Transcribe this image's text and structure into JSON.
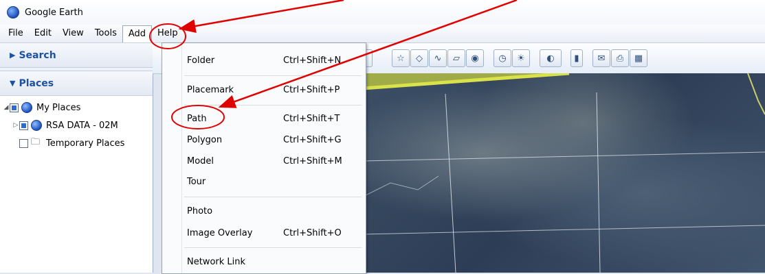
{
  "window": {
    "title": "Google Earth"
  },
  "menubar": {
    "items": [
      {
        "label": "File"
      },
      {
        "label": "Edit"
      },
      {
        "label": "View"
      },
      {
        "label": "Tools"
      },
      {
        "label": "Add",
        "active": true
      },
      {
        "label": "Help"
      }
    ]
  },
  "left_panel": {
    "search_label": "Search",
    "places_label": "Places",
    "tree": [
      {
        "label": "My Places",
        "checked": true,
        "icon": "globe-icon"
      },
      {
        "label": "RSA DATA - 02M",
        "checked": true,
        "icon": "globe-icon"
      },
      {
        "label": "Temporary Places",
        "checked": false,
        "icon": "folder-icon"
      }
    ]
  },
  "add_menu": {
    "items": [
      {
        "label": "Folder",
        "shortcut": "Ctrl+Shift+N"
      },
      {
        "label": "Placemark",
        "shortcut": "Ctrl+Shift+P"
      },
      {
        "label": "Path",
        "shortcut": "Ctrl+Shift+T"
      },
      {
        "label": "Polygon",
        "shortcut": "Ctrl+Shift+G"
      },
      {
        "label": "Model",
        "shortcut": "Ctrl+Shift+M"
      },
      {
        "label": "Tour",
        "shortcut": ""
      },
      {
        "label": "Photo",
        "shortcut": ""
      },
      {
        "label": "Image Overlay",
        "shortcut": "Ctrl+Shift+O"
      },
      {
        "label": "Network Link",
        "shortcut": ""
      }
    ]
  },
  "toolbar": {
    "icons": [
      "placemark-icon",
      "polygon-icon",
      "path-icon",
      "image-overlay-icon",
      "record-tour-icon",
      "historical-imagery-icon",
      "sunlight-icon",
      "planets-icon",
      "ruler-icon",
      "email-icon",
      "print-icon",
      "view-in-maps-icon"
    ]
  },
  "colors": {
    "annotation": "#e00000",
    "places_header": "#1b52a3",
    "boundary_line": "#d9e24a"
  }
}
